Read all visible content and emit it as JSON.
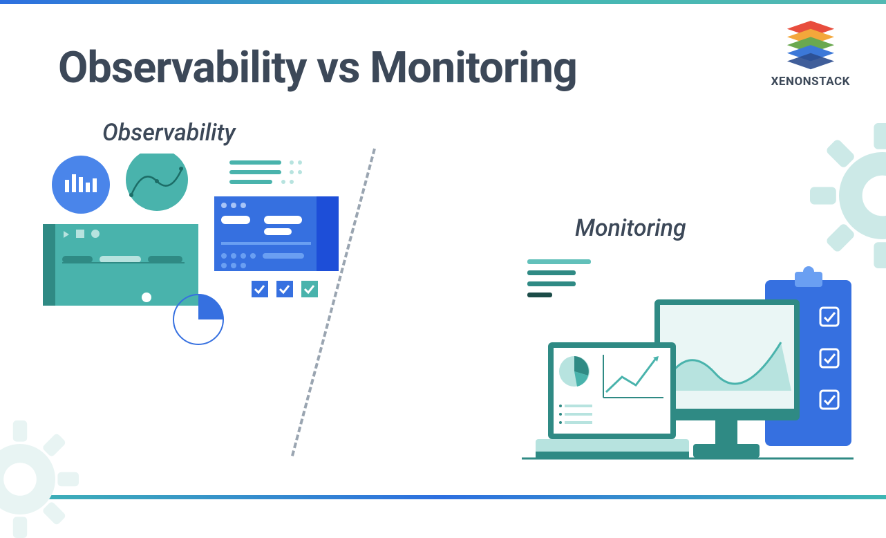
{
  "title": "Observability vs Monitoring",
  "brand": "XENONSTACK",
  "sections": {
    "observability": "Observability",
    "monitoring": "Monitoring"
  },
  "colors": {
    "heading": "#3c4858",
    "teal": "#49b3ac",
    "teal_light": "#b7e3df",
    "teal_dark": "#2f8a84",
    "blue": "#3670e0",
    "blue_light": "#6a9ff2",
    "navy": "#1d4ed8",
    "gear": "#cce9e7",
    "divider": "#9aa5b1"
  }
}
